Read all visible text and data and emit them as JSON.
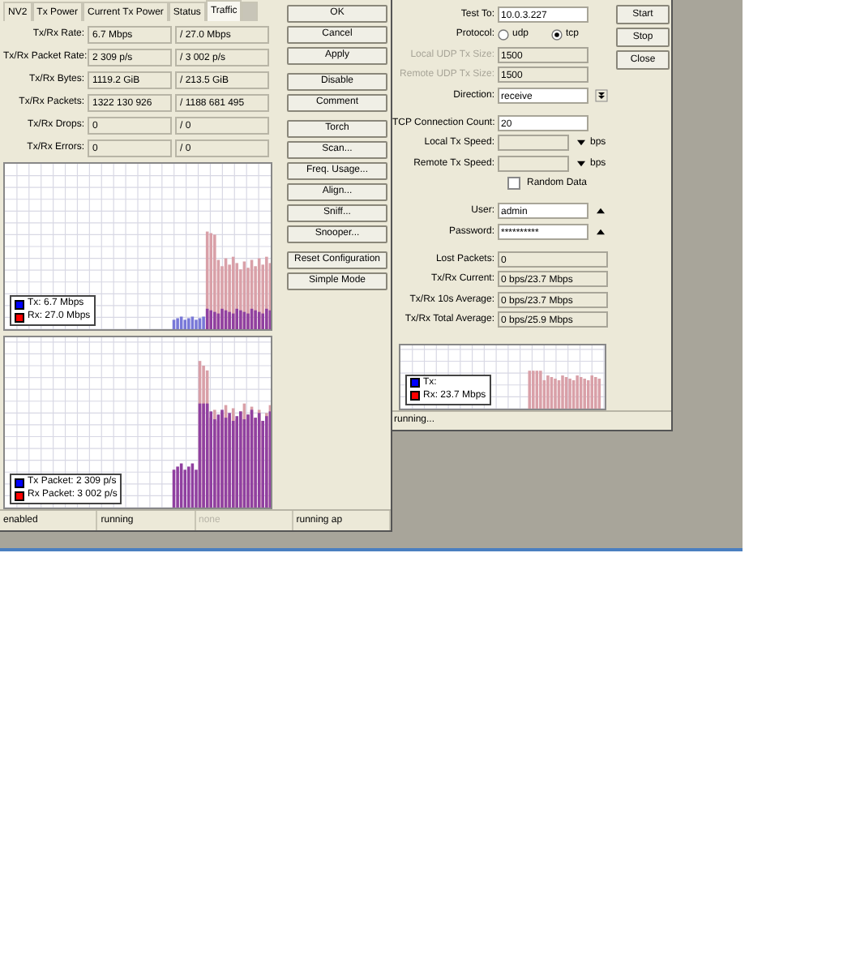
{
  "main_window": {
    "tabs": [
      {
        "label": "NV2",
        "selected": false
      },
      {
        "label": "Tx Power",
        "selected": false
      },
      {
        "label": "Current Tx Power",
        "selected": false
      },
      {
        "label": "Status",
        "selected": false
      },
      {
        "label": "Traffic",
        "selected": true
      }
    ],
    "stats": [
      {
        "label": "Tx/Rx Rate:",
        "tx": "6.7 Mbps",
        "rx": "/ 27.0 Mbps"
      },
      {
        "label": "Tx/Rx Packet Rate:",
        "tx": "2 309 p/s",
        "rx": "/ 3 002 p/s"
      },
      {
        "label": "Tx/Rx Bytes:",
        "tx": "1119.2 GiB",
        "rx": "/ 213.5 GiB"
      },
      {
        "label": "Tx/Rx Packets:",
        "tx": "1322 130 926",
        "rx": "/ 1188 681 495"
      },
      {
        "label": "Tx/Rx Drops:",
        "tx": "0",
        "rx": "/ 0"
      },
      {
        "label": "Tx/Rx Errors:",
        "tx": "0",
        "rx": "/ 0"
      }
    ],
    "graphs": [
      {
        "kind": "rate",
        "legend": [
          {
            "label": "Tx:  6.7 Mbps",
            "color": "#0000ff"
          },
          {
            "label": "Rx:  27.0 Mbps",
            "color": "#ff0000"
          }
        ]
      },
      {
        "kind": "packets",
        "legend": [
          {
            "label": "Tx Packet:  2 309 p/s",
            "color": "#0000ff"
          },
          {
            "label": "Rx Packet:  3 002 p/s",
            "color": "#ff0000"
          }
        ]
      }
    ],
    "button_groups": [
      [
        "OK",
        "Cancel",
        "Apply"
      ],
      [
        "Disable",
        "Comment"
      ],
      [
        "Torch",
        "Scan...",
        "Freq. Usage...",
        "Align...",
        "Sniff...",
        "Snooper..."
      ],
      [
        "Reset Configuration",
        "Simple Mode"
      ]
    ],
    "status_bar": [
      {
        "text": "enabled",
        "disabled": false
      },
      {
        "text": "running",
        "disabled": false
      },
      {
        "text": "none",
        "disabled": true
      },
      {
        "text": "running ap",
        "disabled": false
      }
    ]
  },
  "bandwidth_test": {
    "sections": [
      {
        "fields": [
          {
            "kind": "text",
            "label": "Test To:",
            "value": "10.0.3.227",
            "disabled": false
          },
          {
            "kind": "radio",
            "label": "Protocol:",
            "options": [
              {
                "label": "udp",
                "selected": false
              },
              {
                "label": "tcp",
                "selected": true
              }
            ]
          },
          {
            "kind": "text",
            "label": "Local UDP Tx Size:",
            "value": "1500",
            "disabled": true
          },
          {
            "kind": "text",
            "label": "Remote UDP Tx Size:",
            "value": "1500",
            "disabled": true
          },
          {
            "kind": "select",
            "label": "Direction:",
            "value": "receive"
          }
        ]
      },
      {
        "fields": [
          {
            "kind": "text",
            "label": "TCP Connection Count:",
            "value": "20",
            "disabled": false
          },
          {
            "kind": "speed",
            "label": "Local Tx Speed:",
            "unit": "bps",
            "disabled": true
          },
          {
            "kind": "speed",
            "label": "Remote Tx Speed:",
            "unit": "bps",
            "disabled": true
          },
          {
            "kind": "checkbox",
            "label": "Random Data",
            "checked": false
          }
        ]
      },
      {
        "fields": [
          {
            "kind": "toggle",
            "label": "User:",
            "value": "admin"
          },
          {
            "kind": "toggle",
            "label": "Password:",
            "value": "**********"
          }
        ]
      },
      {
        "fields": [
          {
            "kind": "readonly",
            "label": "Lost Packets:",
            "value": "0"
          },
          {
            "kind": "readonly",
            "label": "Tx/Rx Current:",
            "value": "0 bps/23.7 Mbps"
          },
          {
            "kind": "readonly",
            "label": "Tx/Rx 10s Average:",
            "value": "0 bps/23.7 Mbps"
          },
          {
            "kind": "readonly",
            "label": "Tx/Rx Total Average:",
            "value": "0 bps/25.9 Mbps"
          }
        ]
      }
    ],
    "graph": {
      "legend": [
        {
          "label": "Tx:",
          "color": "#0000ff"
        },
        {
          "label": "Rx:  23.7 Mbps",
          "color": "#ff0000"
        }
      ]
    },
    "buttons": [
      "Start",
      "Stop",
      "Close"
    ],
    "status": "running..."
  }
}
